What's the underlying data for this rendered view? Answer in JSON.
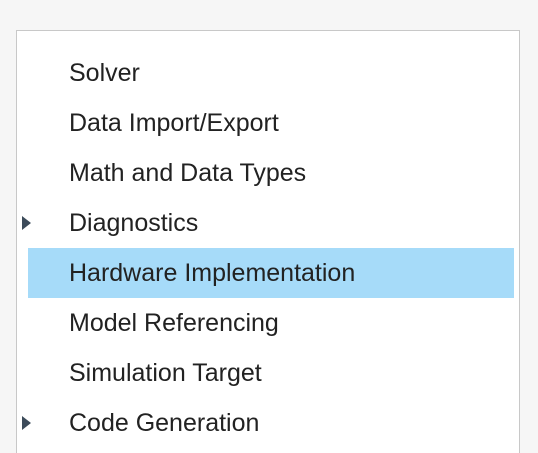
{
  "tree": {
    "items": [
      {
        "label": "Solver",
        "expandable": false,
        "selected": false
      },
      {
        "label": "Data Import/Export",
        "expandable": false,
        "selected": false
      },
      {
        "label": "Math and Data Types",
        "expandable": false,
        "selected": false
      },
      {
        "label": "Diagnostics",
        "expandable": true,
        "selected": false,
        "icon": "caret-right-icon"
      },
      {
        "label": "Hardware Implementation",
        "expandable": false,
        "selected": true
      },
      {
        "label": "Model Referencing",
        "expandable": false,
        "selected": false
      },
      {
        "label": "Simulation Target",
        "expandable": false,
        "selected": false
      },
      {
        "label": "Code Generation",
        "expandable": true,
        "selected": false,
        "icon": "caret-right-icon"
      }
    ]
  },
  "colors": {
    "selection": "#a6dbf9",
    "text": "#222222",
    "caret": "#3c4b5a",
    "panel_border": "#c8c8c8",
    "background": "#f6f6f6"
  }
}
